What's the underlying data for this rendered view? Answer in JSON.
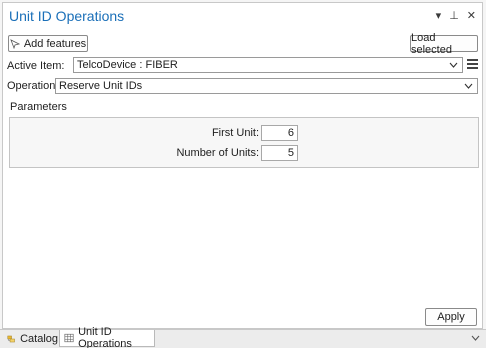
{
  "window": {
    "title": "Unit ID Operations",
    "icons": [
      "chevron-down-icon",
      "pin-icon",
      "close-icon"
    ]
  },
  "toolbar": {
    "add_features_label": "Add features",
    "load_selected_label": "Load selected"
  },
  "active_item": {
    "label": "Active Item:",
    "value": "TelcoDevice : FIBER"
  },
  "operation": {
    "label": "Operation:",
    "value": "Reserve Unit IDs"
  },
  "parameters": {
    "section_label": "Parameters",
    "first_unit_label": "First Unit:",
    "first_unit_value": "6",
    "number_of_units_label": "Number of Units:",
    "number_of_units_value": "5"
  },
  "footer": {
    "apply_label": "Apply"
  },
  "tabs": [
    {
      "label": "Catalog",
      "icon": "catalog-icon"
    },
    {
      "label": "Unit ID Operations",
      "icon": "table-icon",
      "active": true
    }
  ],
  "colors": {
    "title": "#1a6fb8",
    "panel_bg": "#ffffff",
    "params_bg": "#f7f7f7"
  }
}
